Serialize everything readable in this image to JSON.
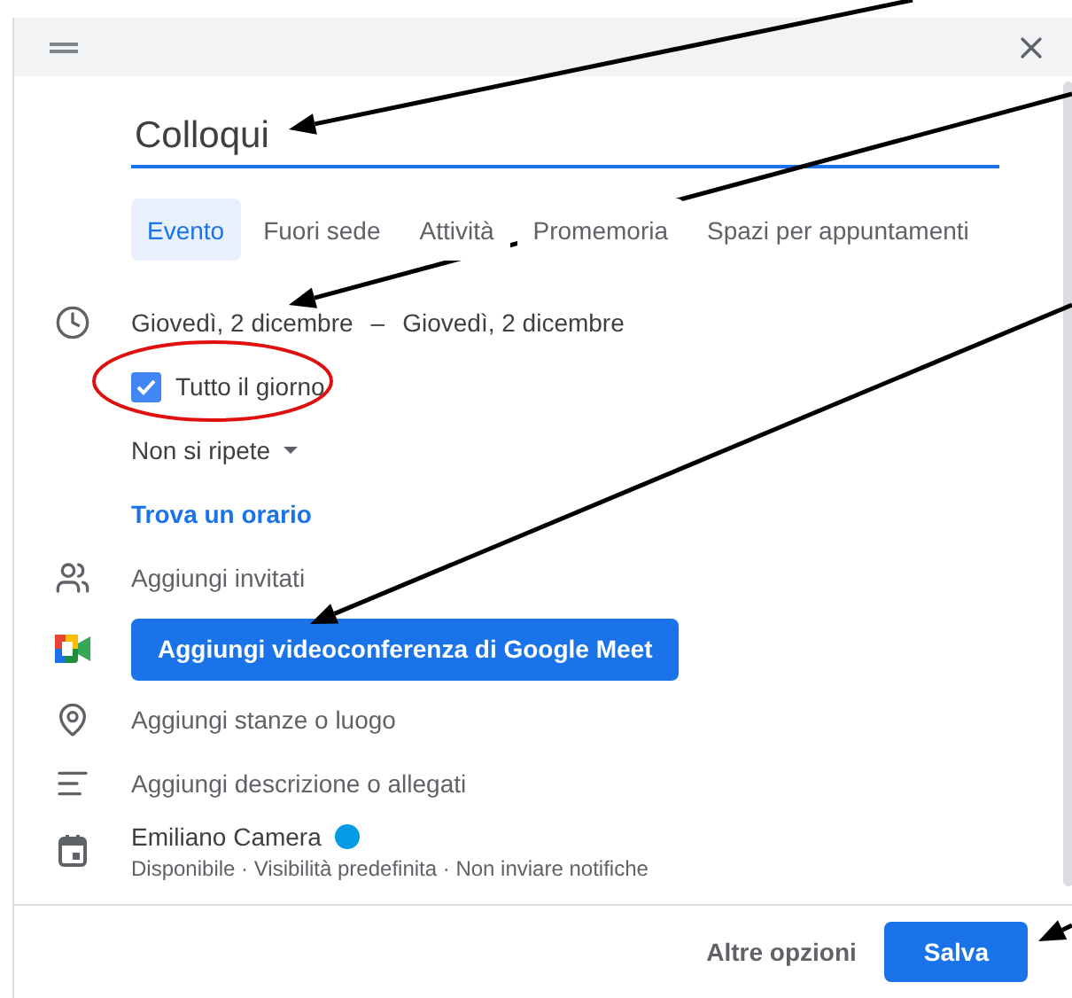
{
  "dialog": {
    "title_value": "Colloqui"
  },
  "tabs": [
    {
      "label": "Evento",
      "selected": true
    },
    {
      "label": "Fuori sede",
      "selected": false
    },
    {
      "label": "Attività",
      "selected": false
    },
    {
      "label": "Promemoria",
      "selected": false
    },
    {
      "label": "Spazi per appuntamenti",
      "selected": false
    }
  ],
  "date": {
    "start": "Giovedì, 2 dicembre",
    "separator": "–",
    "end": "Giovedì, 2 dicembre"
  },
  "all_day": {
    "label": "Tutto il giorno",
    "checked": true
  },
  "recurrence": "Non si ripete",
  "find_time_link": "Trova un orario",
  "guests": "Aggiungi invitati",
  "meet_button": "Aggiungi videoconferenza di Google Meet",
  "location": "Aggiungi stanze o luogo",
  "description": "Aggiungi descrizione o allegati",
  "calendar": {
    "owner": "Emiliano Camera",
    "color": "#039be5",
    "details": "Disponibile · Visibilità predefinita · Non inviare notifiche"
  },
  "footer": {
    "more_options": "Altre opzioni",
    "save": "Salva"
  }
}
